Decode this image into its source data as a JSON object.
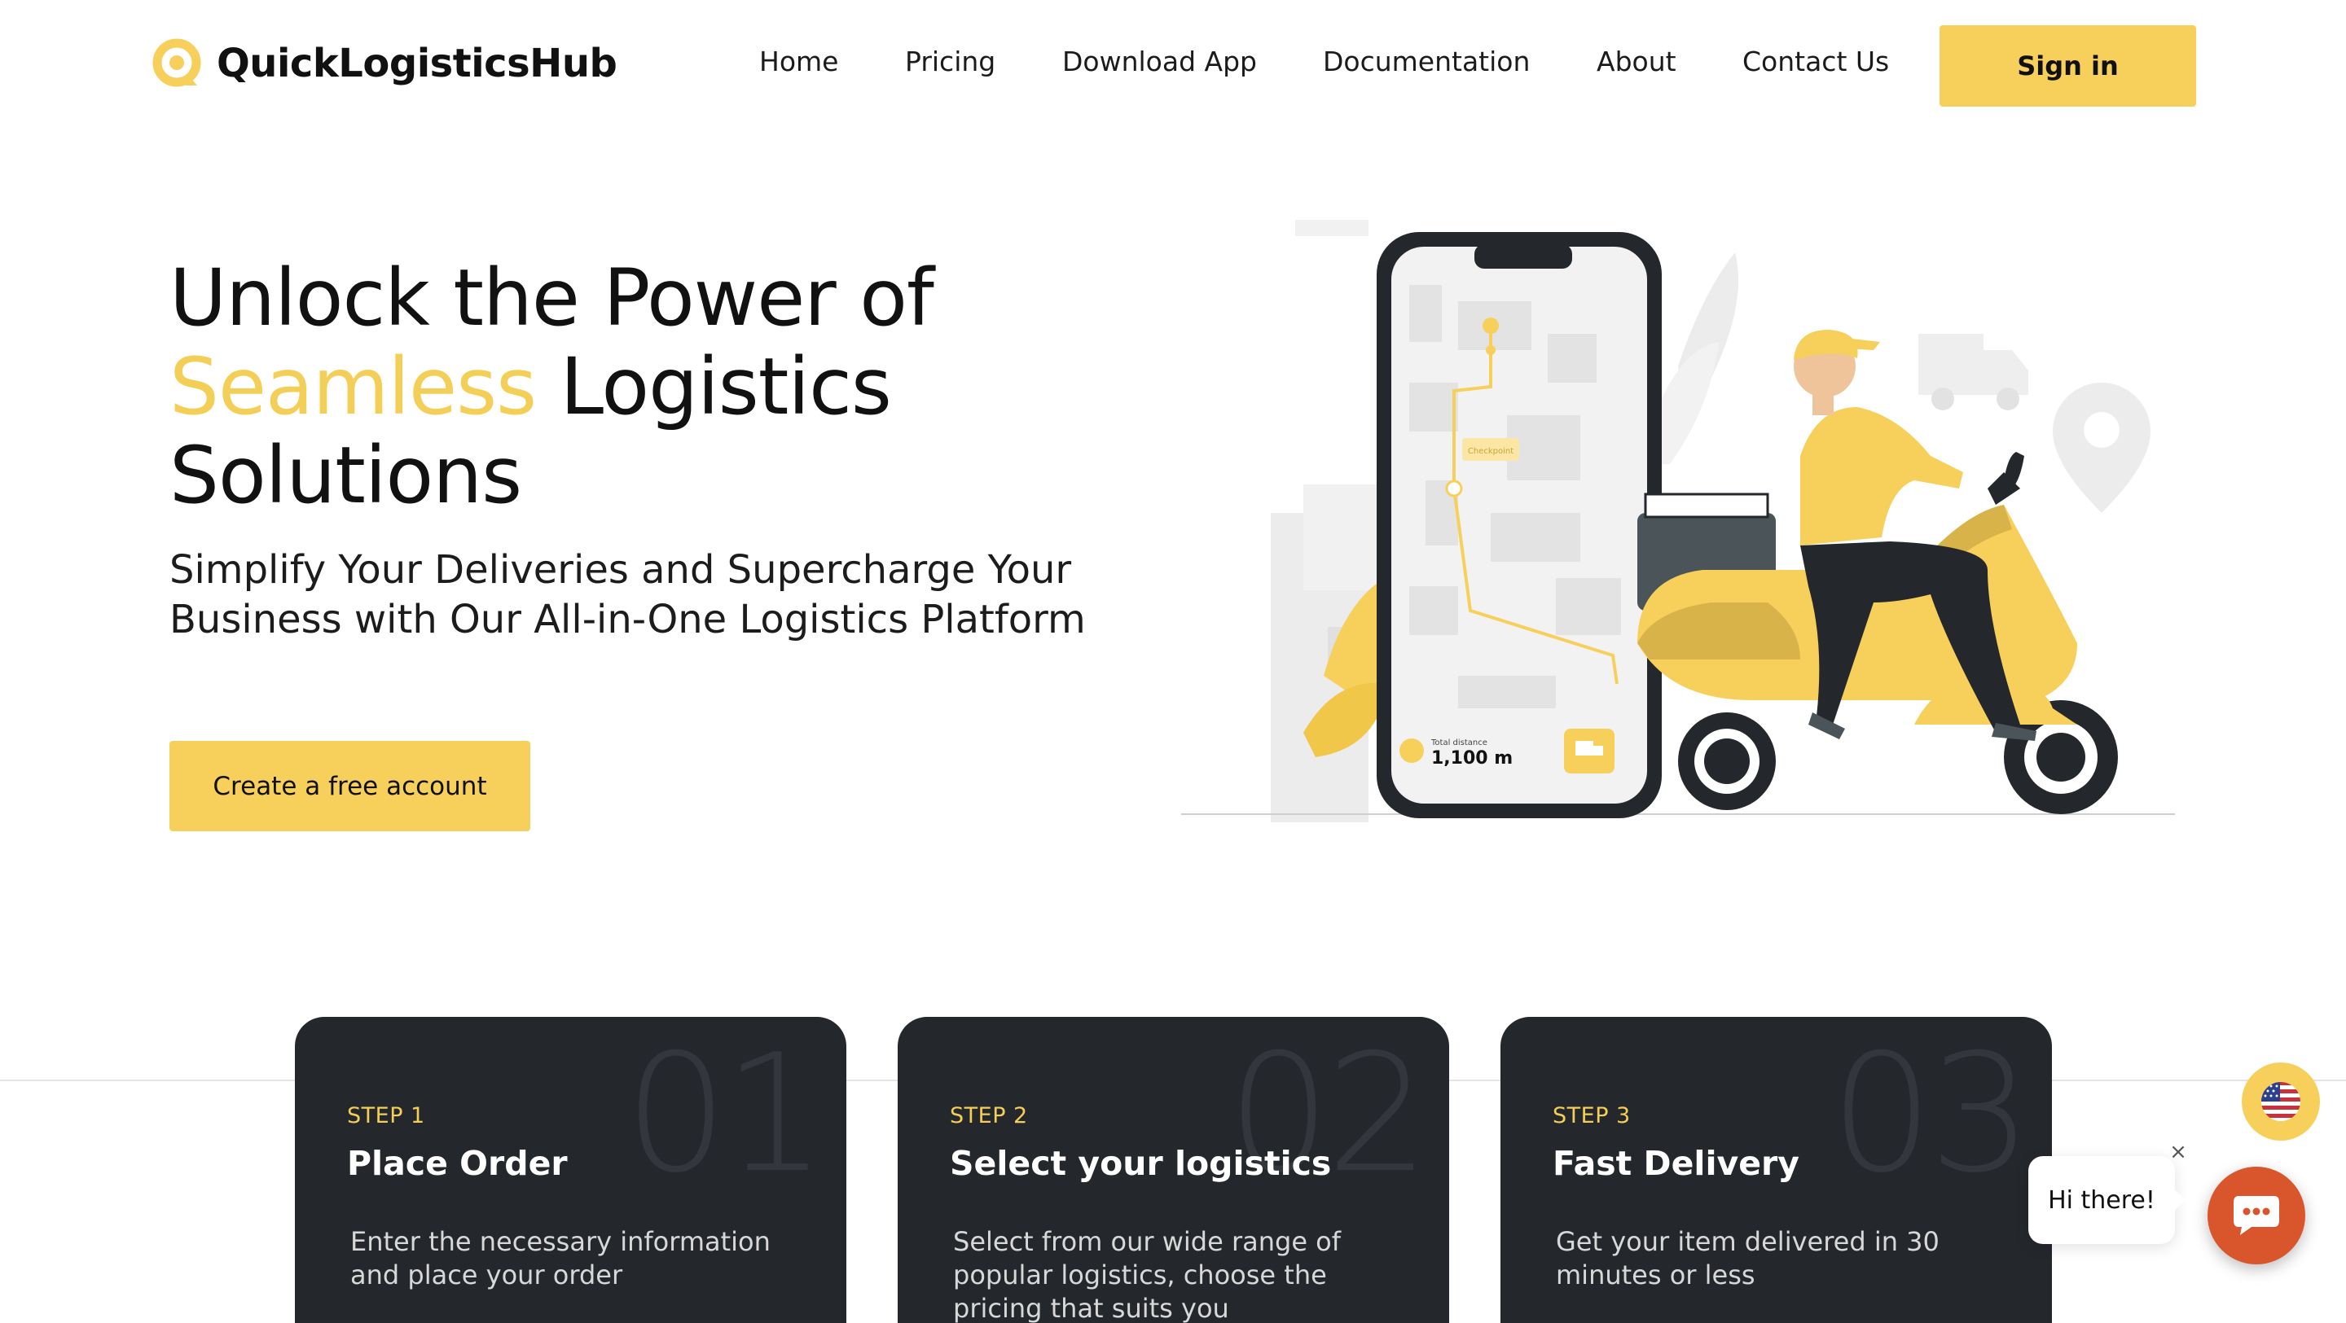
{
  "header": {
    "logo_text": "QuickLogisticsHub",
    "nav": [
      "Home",
      "Pricing",
      "Download App",
      "Documentation",
      "About",
      "Contact Us"
    ],
    "signin_label": "Sign in"
  },
  "hero": {
    "title_line1": "Unlock the Power of",
    "title_accent": "Seamless",
    "title_line2_rest": " Logistics",
    "title_line3": "Solutions",
    "subtitle_line1": "Simplify Your Deliveries and Supercharge Your",
    "subtitle_line2": "Business with Our All-in-One Logistics Platform",
    "cta_label": "Create a free account",
    "illustration": {
      "map_label": "Checkpoint",
      "distance_caption": "Total distance",
      "distance_value": "1,100 m"
    }
  },
  "steps": [
    {
      "number": "01",
      "label": "STEP 1",
      "title": "Place Order",
      "description": "Enter the necessary information and place your order"
    },
    {
      "number": "02",
      "label": "STEP 2",
      "title": "Select your logistics",
      "description": "Select from our wide range of popular logistics, choose the pricing that suits you"
    },
    {
      "number": "03",
      "label": "STEP 3",
      "title": "Fast Delivery",
      "description": "Get your item delivered in 30 minutes or less"
    }
  ],
  "widgets": {
    "chat_greeting": "Hi there!",
    "close_glyph": "×",
    "language_icon": "us-flag-icon",
    "chat_icon": "chat-icon"
  },
  "colors": {
    "accent": "#f6d05b",
    "accent_text": "#f4cf58",
    "card_bg": "#24272c",
    "chat_button": "#d9552b",
    "text": "#111111"
  }
}
